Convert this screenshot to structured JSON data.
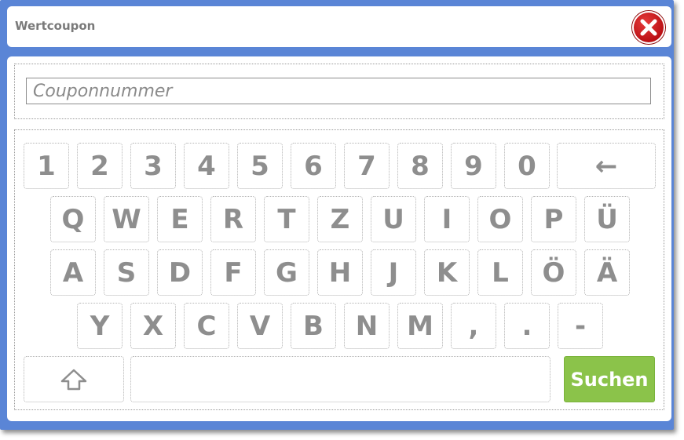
{
  "dialog": {
    "title": "Wertcoupon",
    "close_icon": "close-x-icon"
  },
  "coupon": {
    "placeholder": "Couponnummer",
    "value": ""
  },
  "keyboard": {
    "row1": [
      "1",
      "2",
      "3",
      "4",
      "5",
      "6",
      "7",
      "8",
      "9",
      "0"
    ],
    "backspace_label": "←",
    "row2": [
      "Q",
      "W",
      "E",
      "R",
      "T",
      "Z",
      "U",
      "I",
      "O",
      "P",
      "Ü"
    ],
    "row3": [
      "A",
      "S",
      "D",
      "F",
      "G",
      "H",
      "J",
      "K",
      "L",
      "Ö",
      "Ä"
    ],
    "row4": [
      "Y",
      "X",
      "C",
      "V",
      "B",
      "N",
      "M",
      ",",
      ".",
      "-"
    ],
    "shift_icon": "shift-arrow-icon",
    "space_label": "",
    "search_label": "Suchen"
  },
  "colors": {
    "frame": "#5a85d6",
    "close": "#c8171c",
    "search": "#8bc34a",
    "key_text": "#8e8e8e"
  }
}
